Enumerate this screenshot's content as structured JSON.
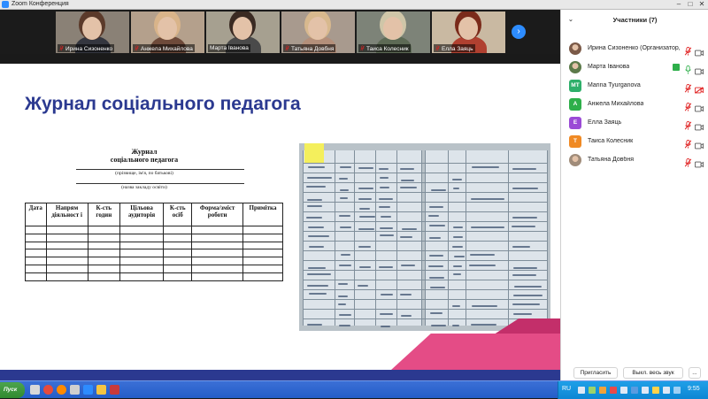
{
  "window": {
    "title": "Zoom Конференция"
  },
  "participants_strip": [
    {
      "name": "Ирина Сизоненко",
      "muted": true,
      "bg": "#8a8176",
      "hair": "#5b3a2a",
      "shirt": "#34363f"
    },
    {
      "name": "Анжела Михайлова",
      "muted": true,
      "bg": "#b4a08c",
      "hair": "#d9b48a",
      "shirt": "#6e4a3a"
    },
    {
      "name": "Марта Іванова",
      "muted": false,
      "bg": "#a6a090",
      "hair": "#3a2a22",
      "shirt": "#4a4a4a"
    },
    {
      "name": "Татьяна Довбня",
      "muted": true,
      "bg": "#a89a8e",
      "hair": "#d8b98e",
      "shirt": "#b48f7a"
    },
    {
      "name": "Таиса Колесник",
      "muted": true,
      "bg": "#7d8378",
      "hair": "#cfc6a8",
      "shirt": "#5d6a55"
    },
    {
      "name": "Елла Заяць",
      "muted": true,
      "bg": "#c9b9a2",
      "hair": "#7a2a1a",
      "shirt": "#b04030"
    }
  ],
  "slide": {
    "title": "Журнал соціального педагога",
    "document": {
      "title_line1": "Журнал",
      "title_line2": "соціального педагога",
      "caption1": "(прізвище, ім'я, по батькові)",
      "caption2": "(назва закладу освіти)",
      "columns": [
        "Дата",
        "Напрям діяльност і",
        "К-сть годин",
        "Цільова аудиторія",
        "К-сть осіб",
        "Форма/зміст роботи",
        "Примітка"
      ]
    }
  },
  "panel": {
    "title": "Участники (7)",
    "participants": [
      {
        "name": "Ирина Сизоненко (Организатор, я)",
        "initial": "",
        "avatar_color": "#7b5a48",
        "muted": true,
        "video_off": false,
        "sharing": false
      },
      {
        "name": "Марта Іванова",
        "initial": "",
        "avatar_color": "#5c7a4a",
        "muted": false,
        "video_off": false,
        "sharing": true
      },
      {
        "name": "Marina Tyurganova",
        "initial": "MT",
        "avatar_color": "#2eaf6a",
        "muted": true,
        "video_off": true,
        "sharing": false
      },
      {
        "name": "Анжела Михайлова",
        "initial": "А",
        "avatar_color": "#2eaf4a",
        "muted": true,
        "video_off": false,
        "sharing": false
      },
      {
        "name": "Елла Заяць",
        "initial": "Е",
        "avatar_color": "#9b4bd6",
        "muted": true,
        "video_off": false,
        "sharing": false
      },
      {
        "name": "Таиса Колесник",
        "initial": "Т",
        "avatar_color": "#f08a24",
        "muted": true,
        "video_off": false,
        "sharing": false
      },
      {
        "name": "Татьяна Довбня",
        "initial": "",
        "avatar_color": "#a08c7a",
        "muted": true,
        "video_off": false,
        "sharing": false
      }
    ],
    "invite_label": "Пригласить",
    "mute_all_label": "Выкл. весь звук",
    "more_label": "..."
  },
  "taskbar": {
    "start_label": "Пуск",
    "language": "RU",
    "clock": "9:55"
  },
  "colors": {
    "slide_title": "#2b3990",
    "accent_blue": "#2d8cff",
    "mute_red": "#e02020",
    "pink": "#e44c86"
  }
}
